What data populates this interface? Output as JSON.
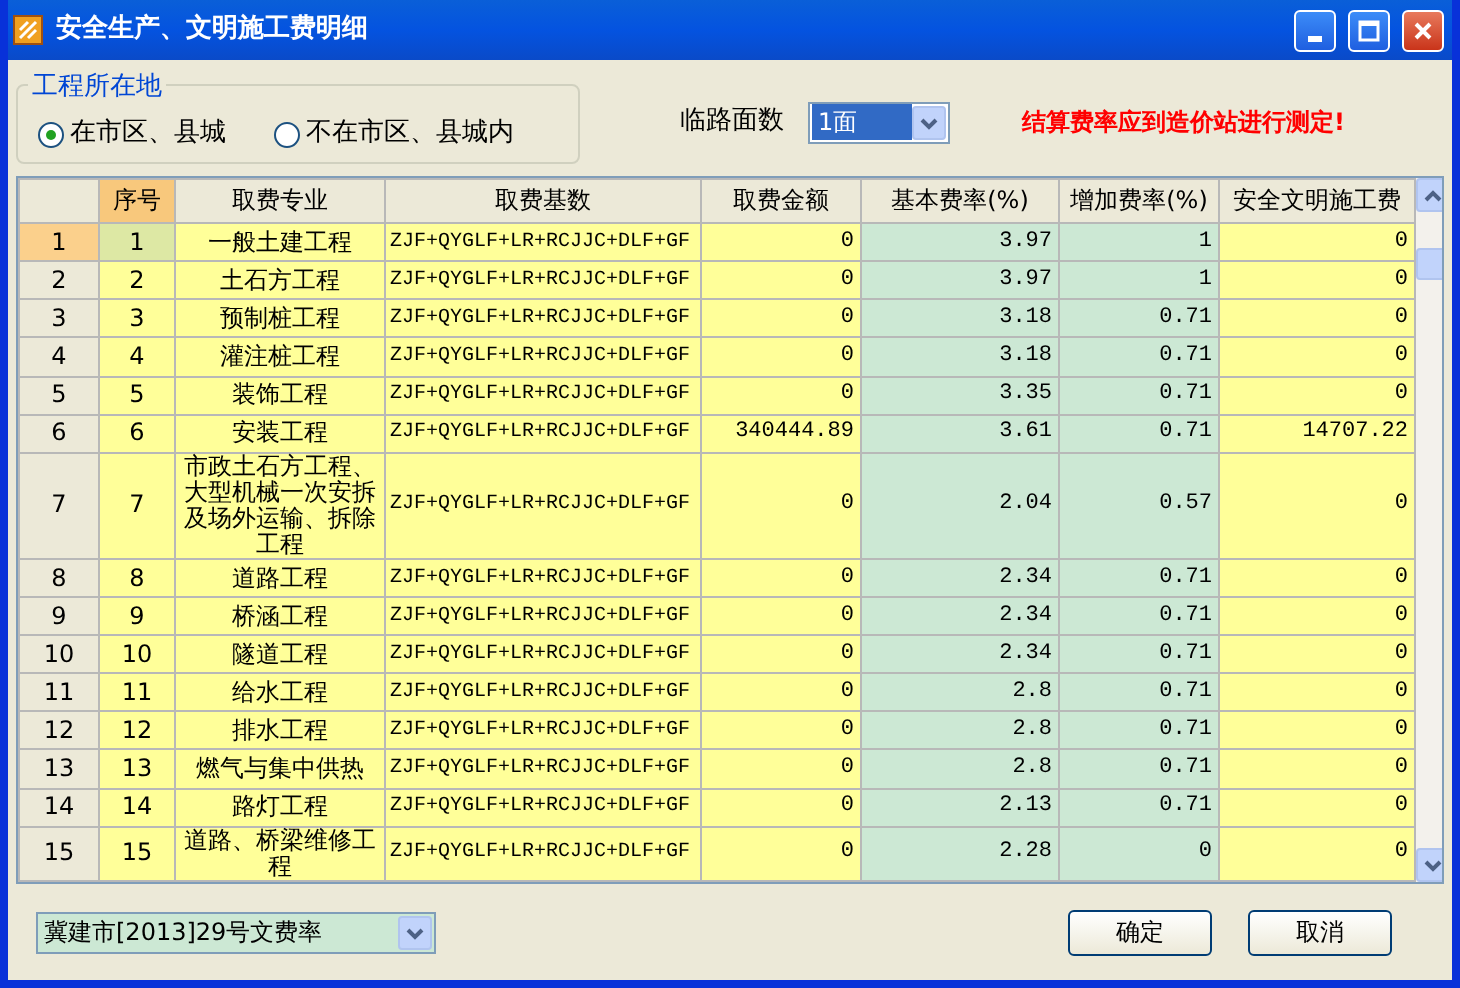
{
  "window": {
    "title": "安全生产、文明施工费明细"
  },
  "location_group": {
    "legend": "工程所在地",
    "options": [
      {
        "label": "在市区、县城",
        "selected": true
      },
      {
        "label": "不在市区、县城内",
        "selected": false
      }
    ]
  },
  "road_sides": {
    "label": "临路面数",
    "value": "1面"
  },
  "notice": "结算费率应到造价站进行测定!",
  "table": {
    "columns": [
      "",
      "序号",
      "取费专业",
      "取费基数",
      "取费金额",
      "基本费率(%)",
      "增加费率(%)",
      "安全文明施工费"
    ],
    "rows": [
      {
        "selected": true,
        "cells": [
          "1",
          "1",
          "一般土建工程",
          "ZJF+QYGLF+LR+RCJJC+DLF+GF",
          "0",
          "3.97",
          "1",
          "0"
        ]
      },
      {
        "selected": false,
        "cells": [
          "2",
          "2",
          "土石方工程",
          "ZJF+QYGLF+LR+RCJJC+DLF+GF",
          "0",
          "3.97",
          "1",
          "0"
        ]
      },
      {
        "selected": false,
        "cells": [
          "3",
          "3",
          "预制桩工程",
          "ZJF+QYGLF+LR+RCJJC+DLF+GF",
          "0",
          "3.18",
          "0.71",
          "0"
        ]
      },
      {
        "selected": false,
        "cells": [
          "4",
          "4",
          "灌注桩工程",
          "ZJF+QYGLF+LR+RCJJC+DLF+GF",
          "0",
          "3.18",
          "0.71",
          "0"
        ]
      },
      {
        "selected": false,
        "cells": [
          "5",
          "5",
          "装饰工程",
          "ZJF+QYGLF+LR+RCJJC+DLF+GF",
          "0",
          "3.35",
          "0.71",
          "0"
        ]
      },
      {
        "selected": false,
        "cells": [
          "6",
          "6",
          "安装工程",
          "ZJF+QYGLF+LR+RCJJC+DLF+GF",
          "340444.89",
          "3.61",
          "0.71",
          "14707.22"
        ]
      },
      {
        "selected": false,
        "cells": [
          "7",
          "7",
          "市政土石方工程、大型机械一次安拆及场外运输、拆除工程",
          "ZJF+QYGLF+LR+RCJJC+DLF+GF",
          "0",
          "2.04",
          "0.57",
          "0"
        ]
      },
      {
        "selected": false,
        "cells": [
          "8",
          "8",
          "道路工程",
          "ZJF+QYGLF+LR+RCJJC+DLF+GF",
          "0",
          "2.34",
          "0.71",
          "0"
        ]
      },
      {
        "selected": false,
        "cells": [
          "9",
          "9",
          "桥涵工程",
          "ZJF+QYGLF+LR+RCJJC+DLF+GF",
          "0",
          "2.34",
          "0.71",
          "0"
        ]
      },
      {
        "selected": false,
        "cells": [
          "10",
          "10",
          "隧道工程",
          "ZJF+QYGLF+LR+RCJJC+DLF+GF",
          "0",
          "2.34",
          "0.71",
          "0"
        ]
      },
      {
        "selected": false,
        "cells": [
          "11",
          "11",
          "给水工程",
          "ZJF+QYGLF+LR+RCJJC+DLF+GF",
          "0",
          "2.8",
          "0.71",
          "0"
        ]
      },
      {
        "selected": false,
        "cells": [
          "12",
          "12",
          "排水工程",
          "ZJF+QYGLF+LR+RCJJC+DLF+GF",
          "0",
          "2.8",
          "0.71",
          "0"
        ]
      },
      {
        "selected": false,
        "cells": [
          "13",
          "13",
          "燃气与集中供热",
          "ZJF+QYGLF+LR+RCJJC+DLF+GF",
          "0",
          "2.8",
          "0.71",
          "0"
        ]
      },
      {
        "selected": false,
        "cells": [
          "14",
          "14",
          "路灯工程",
          "ZJF+QYGLF+LR+RCJJC+DLF+GF",
          "0",
          "2.13",
          "0.71",
          "0"
        ]
      },
      {
        "selected": false,
        "cells": [
          "15",
          "15",
          "道路、桥梁维修工程",
          "ZJF+QYGLF+LR+RCJJC+DLF+GF",
          "0",
          "2.28",
          "0",
          "0"
        ]
      }
    ]
  },
  "rate_file": {
    "value": "冀建市[2013]29号文费率"
  },
  "buttons": [
    "确定",
    "取消"
  ]
}
